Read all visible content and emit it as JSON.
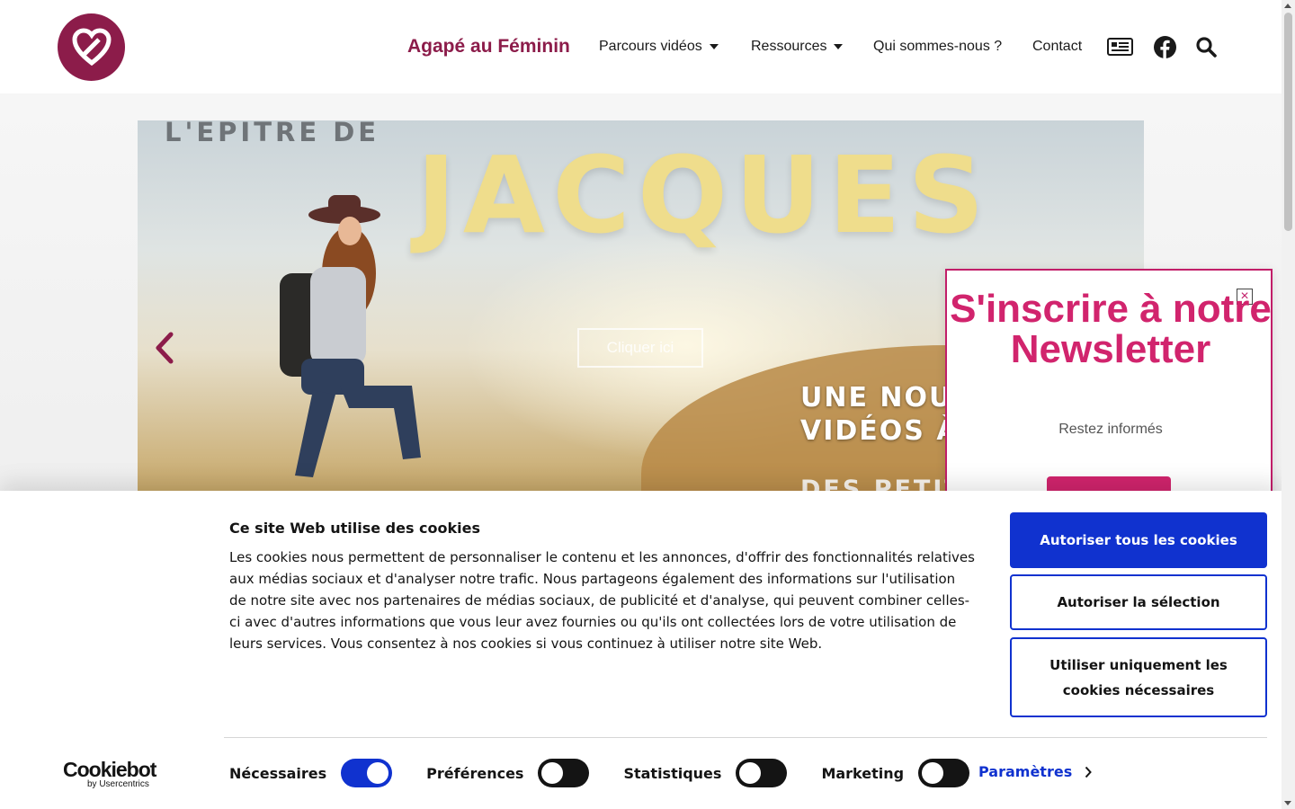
{
  "header": {
    "brand": "Agapé au Féminin",
    "nav": [
      {
        "label": "Parcours vidéos",
        "dropdown": true
      },
      {
        "label": "Ressources",
        "dropdown": true
      },
      {
        "label": "Qui sommes-nous ?",
        "dropdown": false
      },
      {
        "label": "Contact",
        "dropdown": false
      }
    ],
    "icons": [
      "newspaper-icon",
      "facebook-icon",
      "search-icon"
    ],
    "logo_color": "#8c1c4a"
  },
  "slider": {
    "kicker": "L'EPITRE DE",
    "headline": "JACQUES",
    "cta": "Cliquer ici",
    "caption_line1": "UNE NOUVELLE SÉRIE",
    "caption_line2": "VIDÉOS À DÉCOUVRIR",
    "caption_line3": "DES PETITS GROUPES",
    "prev_icon": "chevron-left-icon"
  },
  "newsletter": {
    "title": "S'inscrire à notre Newsletter",
    "subtitle": "Restez informés",
    "close_label": "×",
    "accent": "#d1246d"
  },
  "cookie_banner": {
    "title": "Ce site Web utilise des cookies",
    "body": "Les cookies nous permettent de personnaliser le contenu et les annonces, d'offrir des fonctionnalités relatives aux médias sociaux et d'analyser notre trafic. Nous partageons également des informations sur l'utilisation de notre site avec nos partenaires de médias sociaux, de publicité et d'analyse, qui peuvent combiner celles-ci avec d'autres informations que vous leur avez fournies ou qu'ils ont collectées lors de votre utilisation de leurs services. Vous consentez à nos cookies si vous continuez à utiliser notre site Web.",
    "buttons": {
      "allow_all": "Autoriser tous les cookies",
      "allow_selection": "Autoriser la sélection",
      "necessary_only": "Utiliser uniquement les cookies nécessaires"
    },
    "toggles": [
      {
        "label": "Nécessaires",
        "on": true
      },
      {
        "label": "Préférences",
        "on": false
      },
      {
        "label": "Statistiques",
        "on": false
      },
      {
        "label": "Marketing",
        "on": false
      }
    ],
    "settings_link": "Paramètres",
    "brand_logo": "Cookiebot",
    "brand_by": "by Usercentrics",
    "accent": "#1032cf"
  }
}
